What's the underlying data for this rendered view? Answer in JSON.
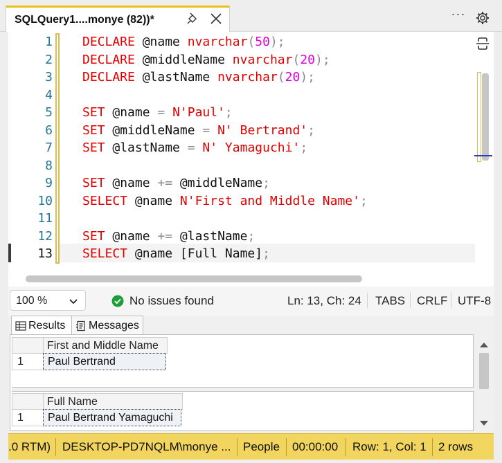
{
  "tab": {
    "title": "SQLQuery1....monye (82))*"
  },
  "editor": {
    "lines": [
      {
        "n": "1",
        "tokens": [
          {
            "t": "DECLARE",
            "c": "kw"
          },
          {
            "t": " ",
            "c": "op"
          },
          {
            "t": "@name",
            "c": "var"
          },
          {
            "t": " ",
            "c": "op"
          },
          {
            "t": "nvarchar",
            "c": "ty"
          },
          {
            "t": "(",
            "c": "pun"
          },
          {
            "t": "50",
            "c": "num"
          },
          {
            "t": ");",
            "c": "pun"
          }
        ]
      },
      {
        "n": "2",
        "tokens": [
          {
            "t": "DECLARE",
            "c": "kw"
          },
          {
            "t": " ",
            "c": "op"
          },
          {
            "t": "@middleName",
            "c": "var"
          },
          {
            "t": " ",
            "c": "op"
          },
          {
            "t": "nvarchar",
            "c": "ty"
          },
          {
            "t": "(",
            "c": "pun"
          },
          {
            "t": "20",
            "c": "num"
          },
          {
            "t": ");",
            "c": "pun"
          }
        ]
      },
      {
        "n": "3",
        "tokens": [
          {
            "t": "DECLARE",
            "c": "kw"
          },
          {
            "t": " ",
            "c": "op"
          },
          {
            "t": "@lastName",
            "c": "var"
          },
          {
            "t": " ",
            "c": "op"
          },
          {
            "t": "nvarchar",
            "c": "ty"
          },
          {
            "t": "(",
            "c": "pun"
          },
          {
            "t": "20",
            "c": "num"
          },
          {
            "t": ");",
            "c": "pun"
          }
        ]
      },
      {
        "n": "4",
        "tokens": []
      },
      {
        "n": "5",
        "tokens": [
          {
            "t": "SET",
            "c": "kw"
          },
          {
            "t": " @name ",
            "c": "var"
          },
          {
            "t": "=",
            "c": "pun"
          },
          {
            "t": " ",
            "c": "op"
          },
          {
            "t": "N'Paul'",
            "c": "str"
          },
          {
            "t": ";",
            "c": "pun"
          }
        ]
      },
      {
        "n": "6",
        "tokens": [
          {
            "t": "SET",
            "c": "kw"
          },
          {
            "t": " @middleName ",
            "c": "var"
          },
          {
            "t": "=",
            "c": "pun"
          },
          {
            "t": " ",
            "c": "op"
          },
          {
            "t": "N' Bertrand'",
            "c": "str"
          },
          {
            "t": ";",
            "c": "pun"
          }
        ]
      },
      {
        "n": "7",
        "tokens": [
          {
            "t": "SET",
            "c": "kw"
          },
          {
            "t": " @lastName ",
            "c": "var"
          },
          {
            "t": "=",
            "c": "pun"
          },
          {
            "t": " ",
            "c": "op"
          },
          {
            "t": "N' Yamaguchi'",
            "c": "str"
          },
          {
            "t": ";",
            "c": "pun"
          }
        ]
      },
      {
        "n": "8",
        "tokens": []
      },
      {
        "n": "9",
        "tokens": [
          {
            "t": "SET",
            "c": "kw"
          },
          {
            "t": " @name ",
            "c": "var"
          },
          {
            "t": "+=",
            "c": "pun"
          },
          {
            "t": " @middleName",
            "c": "var"
          },
          {
            "t": ";",
            "c": "pun"
          }
        ]
      },
      {
        "n": "10",
        "tokens": [
          {
            "t": "SELECT",
            "c": "kw"
          },
          {
            "t": " @name ",
            "c": "var"
          },
          {
            "t": "N'First and Middle Name'",
            "c": "str"
          },
          {
            "t": ";",
            "c": "pun"
          }
        ]
      },
      {
        "n": "11",
        "tokens": []
      },
      {
        "n": "12",
        "tokens": [
          {
            "t": "SET",
            "c": "kw"
          },
          {
            "t": " @name ",
            "c": "var"
          },
          {
            "t": "+=",
            "c": "pun"
          },
          {
            "t": " @lastName",
            "c": "var"
          },
          {
            "t": ";",
            "c": "pun"
          }
        ]
      },
      {
        "n": "13",
        "tokens": [
          {
            "t": "SELECT",
            "c": "kw"
          },
          {
            "t": " @name [Full Name]",
            "c": "var"
          },
          {
            "t": ";",
            "c": "pun"
          }
        ]
      }
    ]
  },
  "status": {
    "zoom": "100 %",
    "issues": "No issues found",
    "position": "Ln: 13, Ch: 24",
    "indent": "TABS",
    "eol": "CRLF",
    "encoding": "UTF-8"
  },
  "results": {
    "tabs": [
      "Results",
      "Messages"
    ],
    "grid1": {
      "header": "First and Middle Name",
      "row_num": "1",
      "value": "Paul Bertrand"
    },
    "grid2": {
      "header": "Full Name",
      "row_num": "1",
      "value": "Paul Bertrand Yamaguchi"
    }
  },
  "bottom": {
    "version": ".0 RTM)",
    "server": "DESKTOP-PD7NQLM\\monye ...",
    "database": "People",
    "elapsed": "00:00:00",
    "cursor": "Row: 1, Col: 1",
    "rows": "2 rows"
  },
  "colors": {
    "accent": "#e8c21a",
    "keyword": "#e00000",
    "number": "#e000e0",
    "line_number": "#237893",
    "status_bar": "#f2d55e",
    "ok": "#1e9e3a"
  }
}
